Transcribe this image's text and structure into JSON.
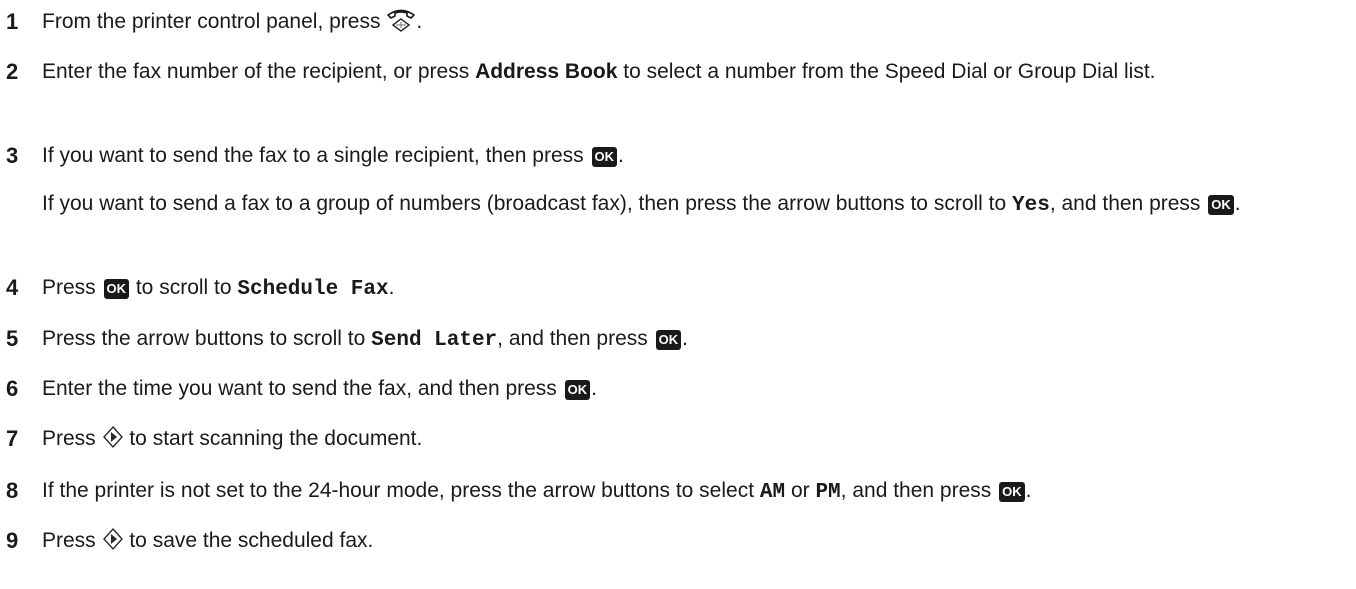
{
  "icons": {
    "fax": "fax-handset-icon",
    "ok": "ok-button-icon",
    "start": "start-diamond-icon"
  },
  "ok_label": "OK",
  "steps": [
    {
      "num": "1",
      "t1": "From the printer control panel, press ",
      "t2": "."
    },
    {
      "num": "2",
      "t1": "Enter the fax number of the recipient, or press ",
      "b1": "Address Book",
      "t2": " to select a number from the Speed Dial or Group Dial list."
    },
    {
      "num": "3",
      "t1": "If you want to send the fax to a single recipient, then press ",
      "t2": ".",
      "p2a": "If you want to send a fax to a group of numbers (broadcast fax), then press the arrow buttons to scroll to ",
      "p2b": "Yes",
      "p2c": ", and then press ",
      "p2d": "."
    },
    {
      "num": "4",
      "t1": "Press ",
      "t2": " to scroll to ",
      "m1": "Schedule Fax",
      "t3": "."
    },
    {
      "num": "5",
      "t1": "Press the arrow buttons to scroll to ",
      "m1": "Send Later",
      "t2": ", and then press ",
      "t3": "."
    },
    {
      "num": "6",
      "t1": "Enter the time you want to send the fax, and then press ",
      "t2": "."
    },
    {
      "num": "7",
      "t1": "Press ",
      "t2": " to start scanning the document."
    },
    {
      "num": "8",
      "t1": "If the printer is not set to the 24-hour mode, press the arrow buttons to select ",
      "m1": "AM",
      "t2": " or ",
      "m2": "PM",
      "t3": ", and then press ",
      "t4": "."
    },
    {
      "num": "9",
      "t1": "Press ",
      "t2": " to save the scheduled fax."
    }
  ]
}
